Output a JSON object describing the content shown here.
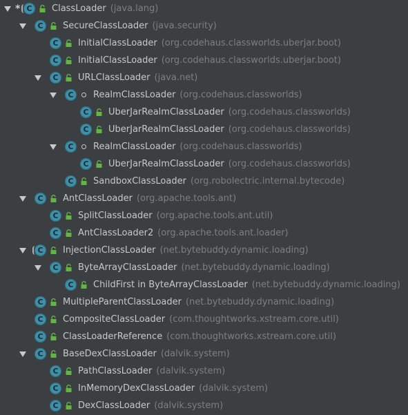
{
  "rows": [
    {
      "name": "ClassLoader",
      "pkg": "(java.lang)",
      "expanded": true,
      "star": true,
      "icon": "abstract-class-icon",
      "access": "public-lock-icon"
    },
    {
      "name": "SecureClassLoader",
      "pkg": "(java.security)",
      "expanded": true,
      "icon": "class-icon",
      "access": "public-lock-icon"
    },
    {
      "name": "InitialClassLoader",
      "pkg": "(org.codehaus.classworlds.uberjar.boot)",
      "expanded": null,
      "icon": "class-icon",
      "access": "public-lock-icon"
    },
    {
      "name": "InitialClassLoader",
      "pkg": "(org.codehaus.classworlds.uberjar.boot)",
      "expanded": null,
      "icon": "class-icon",
      "access": "public-lock-icon"
    },
    {
      "name": "URLClassLoader",
      "pkg": "(java.net)",
      "expanded": true,
      "icon": "class-icon",
      "access": "public-lock-icon"
    },
    {
      "name": "RealmClassLoader",
      "pkg": "(org.codehaus.classworlds)",
      "expanded": true,
      "icon": "class-icon",
      "access": "package-private-icon"
    },
    {
      "name": "UberJarRealmClassLoader",
      "pkg": "(org.codehaus.classworlds)",
      "expanded": null,
      "icon": "class-icon",
      "access": "public-lock-icon"
    },
    {
      "name": "UberJarRealmClassLoader",
      "pkg": "(org.codehaus.classworlds)",
      "expanded": null,
      "icon": "class-icon",
      "access": "public-lock-icon"
    },
    {
      "name": "RealmClassLoader",
      "pkg": "(org.codehaus.classworlds)",
      "expanded": true,
      "icon": "class-icon",
      "access": "package-private-icon"
    },
    {
      "name": "UberJarRealmClassLoader",
      "pkg": "(org.codehaus.classworlds)",
      "expanded": null,
      "icon": "class-icon",
      "access": "public-lock-icon"
    },
    {
      "name": "SandboxClassLoader",
      "pkg": "(org.robolectric.internal.bytecode)",
      "expanded": null,
      "icon": "class-icon",
      "access": "public-lock-icon"
    },
    {
      "name": "AntClassLoader",
      "pkg": "(org.apache.tools.ant)",
      "expanded": true,
      "icon": "class-icon",
      "access": "public-lock-icon"
    },
    {
      "name": "SplitClassLoader",
      "pkg": "(org.apache.tools.ant.util)",
      "expanded": null,
      "icon": "class-icon",
      "access": "public-lock-icon"
    },
    {
      "name": "AntClassLoader2",
      "pkg": "(org.apache.tools.ant.loader)",
      "expanded": null,
      "icon": "class-icon",
      "access": "public-lock-icon"
    },
    {
      "name": "InjectionClassLoader",
      "pkg": "(net.bytebuddy.dynamic.loading)",
      "expanded": true,
      "icon": "abstract-class-icon",
      "access": "public-lock-icon"
    },
    {
      "name": "ByteArrayClassLoader",
      "pkg": "(net.bytebuddy.dynamic.loading)",
      "expanded": true,
      "icon": "class-icon",
      "access": "public-lock-icon"
    },
    {
      "name": "ChildFirst in ByteArrayClassLoader",
      "pkg": "(net.bytebuddy.dynamic.loading)",
      "expanded": null,
      "icon": "class-icon",
      "access": "public-lock-icon"
    },
    {
      "name": "MultipleParentClassLoader",
      "pkg": "(net.bytebuddy.dynamic.loading)",
      "expanded": null,
      "icon": "class-icon",
      "access": "public-lock-icon"
    },
    {
      "name": "CompositeClassLoader",
      "pkg": "(com.thoughtworks.xstream.core.util)",
      "expanded": null,
      "icon": "class-icon",
      "access": "public-lock-icon"
    },
    {
      "name": "ClassLoaderReference",
      "pkg": "(com.thoughtworks.xstream.core.util)",
      "expanded": null,
      "icon": "class-icon",
      "access": "public-lock-icon"
    },
    {
      "name": "BaseDexClassLoader",
      "pkg": "(dalvik.system)",
      "expanded": true,
      "icon": "class-icon",
      "access": "public-lock-icon"
    },
    {
      "name": "PathClassLoader",
      "pkg": "(dalvik.system)",
      "expanded": null,
      "icon": "class-icon",
      "access": "public-lock-icon"
    },
    {
      "name": "InMemoryDexClassLoader",
      "pkg": "(dalvik.system)",
      "expanded": null,
      "icon": "class-icon",
      "access": "public-lock-icon"
    },
    {
      "name": "DexClassLoader",
      "pkg": "(dalvik.system)",
      "expanded": null,
      "icon": "class-icon",
      "access": "public-lock-icon"
    }
  ],
  "colors": {
    "background": "#3c3f41",
    "class_name": "#c8c8c8",
    "package_name": "#7d7f80",
    "class_icon": "#3f8fa8",
    "lock": "#62b543"
  }
}
